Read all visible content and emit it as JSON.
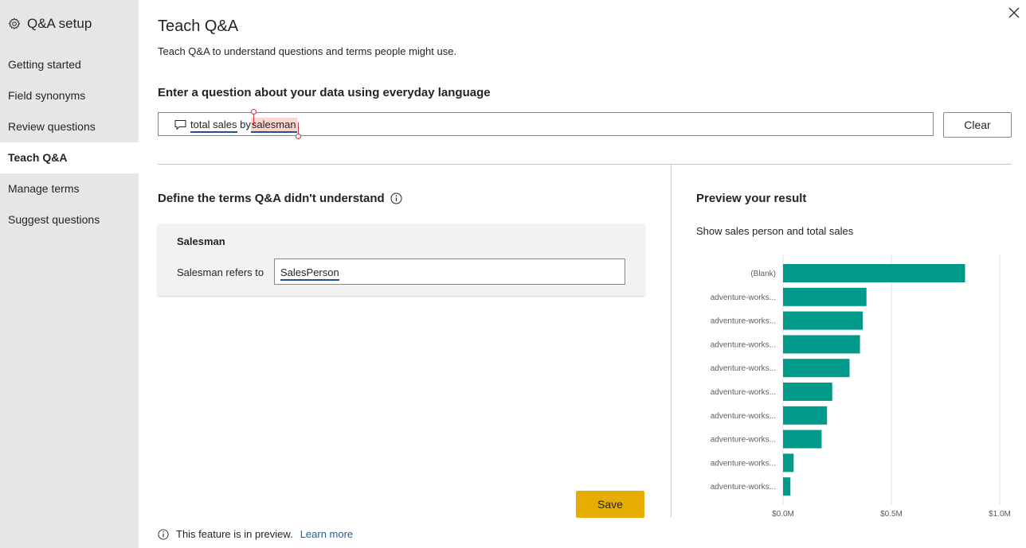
{
  "sidebar": {
    "header": "Q&A setup",
    "items": [
      {
        "label": "Getting started",
        "active": false
      },
      {
        "label": "Field synonyms",
        "active": false
      },
      {
        "label": "Review questions",
        "active": false
      },
      {
        "label": "Teach Q&A",
        "active": true
      },
      {
        "label": "Manage terms",
        "active": false
      },
      {
        "label": "Suggest questions",
        "active": false
      }
    ]
  },
  "header": {
    "title": "Teach Q&A",
    "subtitle": "Teach Q&A to understand questions and terms people might use."
  },
  "question": {
    "label": "Enter a question about your data using everyday language",
    "tokens": {
      "term1": "total sales",
      "connector": "by",
      "term2": "salesman"
    },
    "clear_label": "Clear"
  },
  "define": {
    "title": "Define the terms Q&A didn't understand",
    "term": "Salesman",
    "refers_label": "Salesman refers to",
    "refers_value": "SalesPerson",
    "save_label": "Save"
  },
  "footer": {
    "text": "This feature is in preview.",
    "link": "Learn more"
  },
  "preview": {
    "title": "Preview your result",
    "caption": "Show sales person and total sales"
  },
  "colors": {
    "bar": "#00998a",
    "save_button": "#e6ad00",
    "link": "#1f5fa8",
    "highlight": "#fbd5d0",
    "selection": "#d13438"
  },
  "chart_data": {
    "type": "bar",
    "orientation": "horizontal",
    "categories": [
      "(Blank)",
      "adventure-works...",
      "adventure-works...",
      "adventure-works...",
      "adventure-works...",
      "adventure-works...",
      "adventure-works...",
      "adventure-works...",
      "adventure-works...",
      "adventure-works..."
    ],
    "values": [
      0.84,
      0.385,
      0.368,
      0.355,
      0.307,
      0.227,
      0.203,
      0.178,
      0.049,
      0.034
    ],
    "xlim": [
      0,
      1.0
    ],
    "xticks": [
      {
        "value": 0,
        "label": "$0.0M"
      },
      {
        "value": 0.5,
        "label": "$0.5M"
      },
      {
        "value": 1.0,
        "label": "$1.0M"
      }
    ],
    "grid": true
  }
}
